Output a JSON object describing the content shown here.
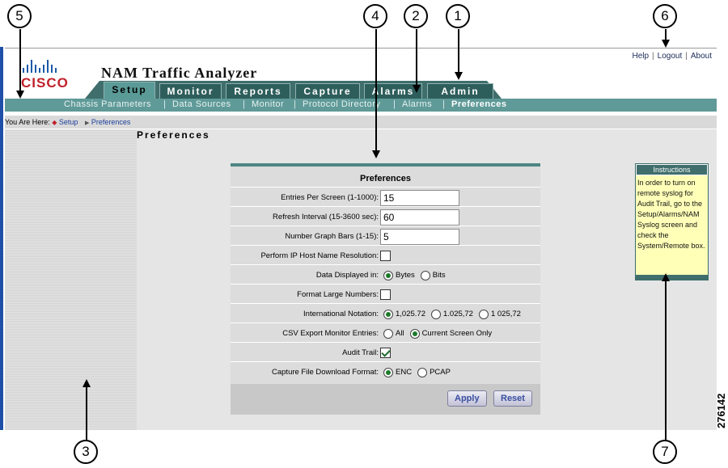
{
  "app": {
    "title": "NAM Traffic Analyzer",
    "logo_text": "cisco"
  },
  "top_links": [
    "Help",
    "Logout",
    "About"
  ],
  "tabs": [
    "Setup",
    "Monitor",
    "Reports",
    "Capture",
    "Alarms",
    "Admin"
  ],
  "active_tab": "Setup",
  "subnav": [
    "Chassis Parameters",
    "Data Sources",
    "Monitor",
    "Protocol Directory",
    "Alarms",
    "Preferences"
  ],
  "active_subnav": "Preferences",
  "breadcrumb": {
    "label": "You Are Here:",
    "items": [
      "Setup",
      "Preferences"
    ]
  },
  "page_title": "Preferences",
  "form": {
    "title": "Preferences",
    "fields": {
      "entries_label": "Entries Per Screen (1-1000):",
      "entries_value": "15",
      "refresh_label": "Refresh Interval (15-3600 sec):",
      "refresh_value": "60",
      "bars_label": "Number Graph Bars (1-15):",
      "bars_value": "5",
      "ip_label": "Perform IP Host Name Resolution:",
      "ip_checked": false,
      "data_label": "Data Displayed in:",
      "data_options": [
        "Bytes",
        "Bits"
      ],
      "data_selected": "Bytes",
      "format_label": "Format Large Numbers:",
      "format_checked": false,
      "intl_label": "International Notation:",
      "intl_options": [
        "1,025.72",
        "1.025,72",
        "1 025,72"
      ],
      "intl_selected": "1,025.72",
      "csv_label": "CSV Export Monitor Entries:",
      "csv_options": [
        "All",
        "Current Screen Only"
      ],
      "csv_selected": "Current Screen Only",
      "audit_label": "Audit Trail:",
      "audit_checked": true,
      "capture_label": "Capture File Download Format:",
      "capture_options": [
        "ENC",
        "PCAP"
      ],
      "capture_selected": "ENC"
    },
    "apply_label": "Apply",
    "reset_label": "Reset"
  },
  "instructions": {
    "title": "Instructions",
    "text": "In order to turn on remote syslog for Audit Trail, go to the Setup/Alarms/NAM Syslog screen and check the System/Remote box."
  },
  "callouts": [
    "1",
    "2",
    "3",
    "4",
    "5",
    "6",
    "7"
  ],
  "figure_id": "276142",
  "colors": {
    "teal": "#3f6e6c",
    "subnav": "#5f9a98",
    "instructions_bg": "#ffffb8",
    "link": "#1c3f9c"
  }
}
